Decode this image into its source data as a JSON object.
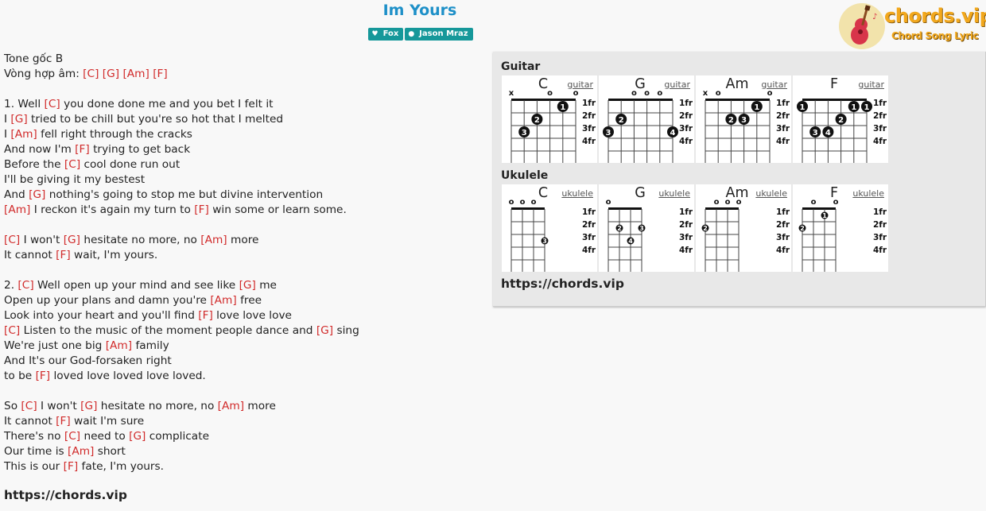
{
  "song": {
    "title": "Im Yours",
    "badges": [
      {
        "label": "Fox",
        "icon": "heart-icon"
      },
      {
        "label": "Jason Mraz",
        "icon": "user-icon"
      }
    ]
  },
  "logo": {
    "text": "chords.vip",
    "subtitle": "Chord Song Lyric"
  },
  "lyrics": [
    [
      {
        "t": "Tone gốc B"
      }
    ],
    [
      {
        "t": "Vòng hợp âm: "
      },
      {
        "c": "[C]"
      },
      {
        "t": " "
      },
      {
        "c": "[G]"
      },
      {
        "t": " "
      },
      {
        "c": "[Am]"
      },
      {
        "t": " "
      },
      {
        "c": "[F]"
      }
    ],
    [],
    [
      {
        "t": "1. Well "
      },
      {
        "c": "[C]"
      },
      {
        "t": " you done done me and you bet I felt it"
      }
    ],
    [
      {
        "t": "I "
      },
      {
        "c": "[G]"
      },
      {
        "t": " tried to be chill but you're so hot that I melted"
      }
    ],
    [
      {
        "t": "I "
      },
      {
        "c": "[Am]"
      },
      {
        "t": " fell right through the cracks"
      }
    ],
    [
      {
        "t": "And now I'm "
      },
      {
        "c": "[F]"
      },
      {
        "t": " trying to get back"
      }
    ],
    [
      {
        "t": "Before the "
      },
      {
        "c": "[C]"
      },
      {
        "t": " cool done run out"
      }
    ],
    [
      {
        "t": "I'll be giving it my bestest"
      }
    ],
    [
      {
        "t": "And "
      },
      {
        "c": "[G]"
      },
      {
        "t": " nothing's going to stop me but divine intervention"
      }
    ],
    [
      {
        "c": "[Am]"
      },
      {
        "t": " I reckon it's again my turn to "
      },
      {
        "c": "[F]"
      },
      {
        "t": " win some or learn some."
      }
    ],
    [],
    [
      {
        "c": "[C]"
      },
      {
        "t": " I won't "
      },
      {
        "c": "[G]"
      },
      {
        "t": " hesitate no more, no "
      },
      {
        "c": "[Am]"
      },
      {
        "t": " more"
      }
    ],
    [
      {
        "t": "It cannot "
      },
      {
        "c": "[F]"
      },
      {
        "t": " wait, I'm yours."
      }
    ],
    [],
    [
      {
        "t": "2. "
      },
      {
        "c": "[C]"
      },
      {
        "t": " Well open up your mind and see like "
      },
      {
        "c": "[G]"
      },
      {
        "t": " me"
      }
    ],
    [
      {
        "t": "Open up your plans and damn you're "
      },
      {
        "c": "[Am]"
      },
      {
        "t": " free"
      }
    ],
    [
      {
        "t": "Look into your heart and you'll find "
      },
      {
        "c": "[F]"
      },
      {
        "t": " love love love"
      }
    ],
    [
      {
        "c": "[C]"
      },
      {
        "t": " Listen to the music of the moment people dance and "
      },
      {
        "c": "[G]"
      },
      {
        "t": " sing"
      }
    ],
    [
      {
        "t": "We're just one big "
      },
      {
        "c": "[Am]"
      },
      {
        "t": " family"
      }
    ],
    [
      {
        "t": "And It's our God-forsaken right"
      }
    ],
    [
      {
        "t": "to be "
      },
      {
        "c": "[F]"
      },
      {
        "t": " loved love loved love loved."
      }
    ],
    [],
    [
      {
        "t": "So "
      },
      {
        "c": "[C]"
      },
      {
        "t": " I won't "
      },
      {
        "c": "[G]"
      },
      {
        "t": " hesitate no more, no "
      },
      {
        "c": "[Am]"
      },
      {
        "t": " more"
      }
    ],
    [
      {
        "t": "It cannot "
      },
      {
        "c": "[F]"
      },
      {
        "t": " wait I'm sure"
      }
    ],
    [
      {
        "t": "There's no "
      },
      {
        "c": "[C]"
      },
      {
        "t": " need to "
      },
      {
        "c": "[G]"
      },
      {
        "t": " complicate"
      }
    ],
    [
      {
        "t": "Our time is "
      },
      {
        "c": "[Am]"
      },
      {
        "t": " short"
      }
    ],
    [
      {
        "t": "This is our "
      },
      {
        "c": "[F]"
      },
      {
        "t": " fate, I'm yours."
      }
    ]
  ],
  "footer_url": "https://chords.vip",
  "panel": {
    "guitar_title": "Guitar",
    "ukulele_title": "Ukulele",
    "url": "https://chords.vip",
    "fret_labels": [
      "1fr",
      "2fr",
      "3fr",
      "4fr"
    ],
    "guitar": [
      {
        "name": "C",
        "link": "guitar",
        "top": [
          "x",
          "",
          "",
          "o",
          "",
          "o"
        ],
        "dots": [
          {
            "s": 4,
            "f": 1,
            "n": "1"
          },
          {
            "s": 2,
            "f": 2,
            "n": "2"
          },
          {
            "s": 1,
            "f": 3,
            "n": "3"
          }
        ]
      },
      {
        "name": "G",
        "link": "guitar",
        "top": [
          "",
          "",
          "o",
          "o",
          "o",
          ""
        ],
        "dots": [
          {
            "s": 1,
            "f": 2,
            "n": "2"
          },
          {
            "s": 0,
            "f": 3,
            "n": "3"
          },
          {
            "s": 5,
            "f": 3,
            "n": "4"
          }
        ]
      },
      {
        "name": "Am",
        "link": "guitar",
        "top": [
          "x",
          "o",
          "",
          "",
          "",
          "o"
        ],
        "dots": [
          {
            "s": 4,
            "f": 1,
            "n": "1"
          },
          {
            "s": 2,
            "f": 2,
            "n": "2"
          },
          {
            "s": 3,
            "f": 2,
            "n": "3"
          }
        ]
      },
      {
        "name": "F",
        "link": "guitar",
        "top": [
          "",
          "",
          "",
          "",
          "",
          ""
        ],
        "dots": [
          {
            "s": 0,
            "f": 1,
            "n": "1"
          },
          {
            "s": 4,
            "f": 1,
            "n": "1"
          },
          {
            "s": 5,
            "f": 1,
            "n": "1"
          },
          {
            "s": 3,
            "f": 2,
            "n": "2"
          },
          {
            "s": 1,
            "f": 3,
            "n": "3"
          },
          {
            "s": 2,
            "f": 3,
            "n": "4"
          }
        ]
      }
    ],
    "ukulele": [
      {
        "name": "C",
        "link": "ukulele",
        "top": [
          "o",
          "o",
          "o",
          ""
        ],
        "dots": [
          {
            "s": 3,
            "f": 3,
            "n": "3"
          }
        ]
      },
      {
        "name": "G",
        "link": "ukulele",
        "top": [
          "o",
          "",
          "",
          ""
        ],
        "dots": [
          {
            "s": 1,
            "f": 2,
            "n": "2"
          },
          {
            "s": 3,
            "f": 2,
            "n": "3"
          },
          {
            "s": 2,
            "f": 3,
            "n": "4"
          }
        ]
      },
      {
        "name": "Am",
        "link": "ukulele",
        "top": [
          "",
          "o",
          "o",
          "o"
        ],
        "dots": [
          {
            "s": 0,
            "f": 2,
            "n": "2"
          }
        ]
      },
      {
        "name": "F",
        "link": "ukulele",
        "top": [
          "",
          "o",
          "",
          "o"
        ],
        "dots": [
          {
            "s": 2,
            "f": 1,
            "n": "1"
          },
          {
            "s": 0,
            "f": 2,
            "n": "2"
          }
        ]
      }
    ]
  }
}
